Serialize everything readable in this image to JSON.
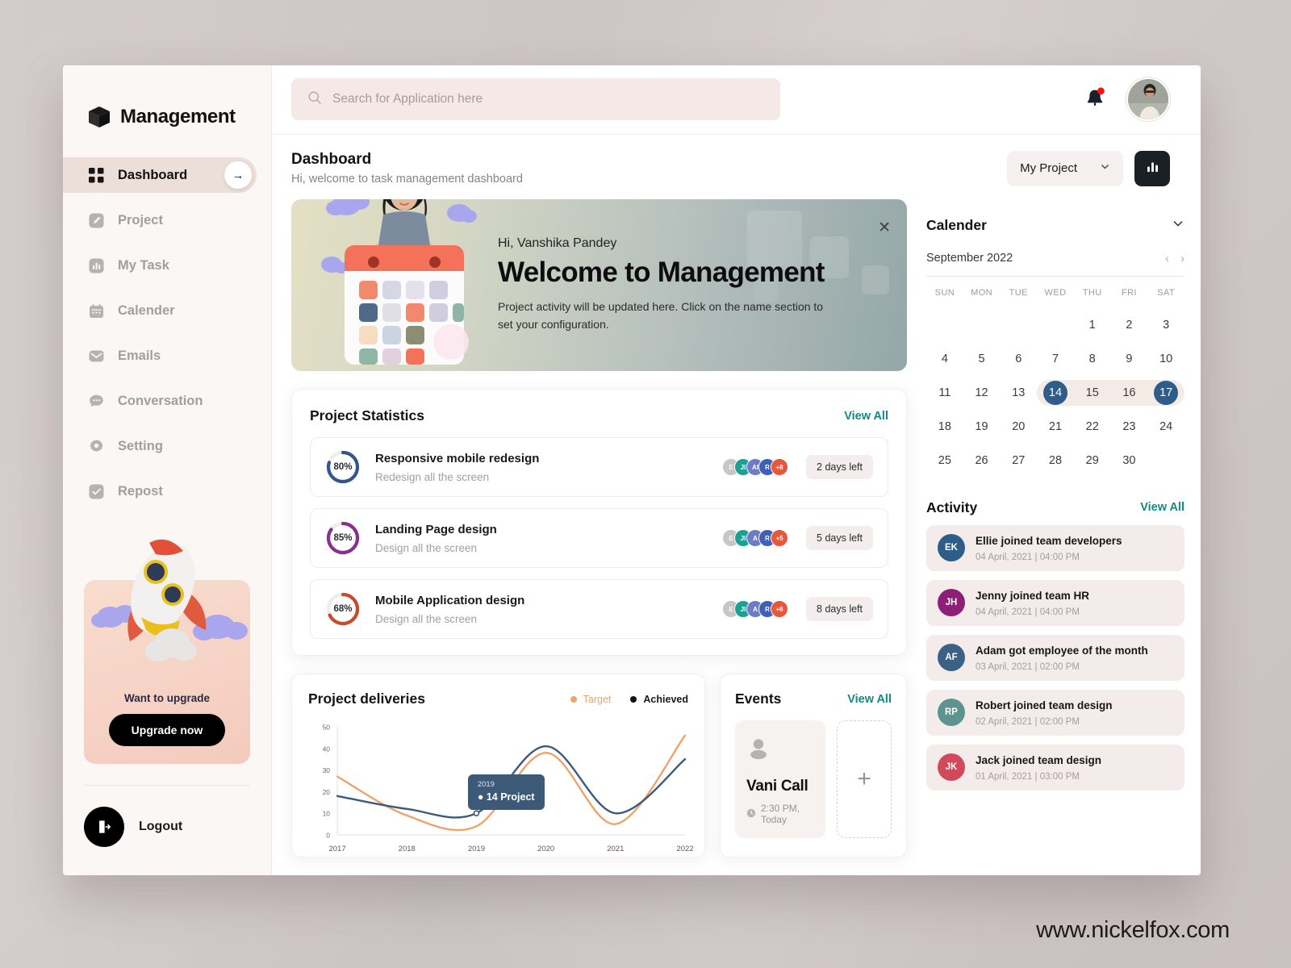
{
  "brand": {
    "name": "Management",
    "logo_icon": "cube-icon"
  },
  "sidebar": {
    "items": [
      {
        "label": "Dashboard",
        "icon": "grid-icon",
        "active": true
      },
      {
        "label": "Project",
        "icon": "edit-icon",
        "active": false
      },
      {
        "label": "My Task",
        "icon": "bar-chart-icon",
        "active": false
      },
      {
        "label": "Calender",
        "icon": "calendar-icon",
        "active": false
      },
      {
        "label": "Emails",
        "icon": "mail-icon",
        "active": false
      },
      {
        "label": "Conversation",
        "icon": "chat-icon",
        "active": false
      },
      {
        "label": "Setting",
        "icon": "gear-icon",
        "active": false
      },
      {
        "label": "Repost",
        "icon": "check-square-icon",
        "active": false
      }
    ],
    "upgrade": {
      "title": "Want to upgrade",
      "button": "Upgrade now",
      "illustration": "rocket-illustration"
    },
    "logout": {
      "label": "Logout",
      "icon": "logout-icon"
    }
  },
  "topbar": {
    "search": {
      "placeholder": "Search for Application here",
      "value": "",
      "icon": "search-icon"
    },
    "notification": {
      "icon": "bell-icon",
      "has_unread": true,
      "badge_color": "#ff0f0f"
    },
    "avatar": {
      "name": "avatar"
    }
  },
  "pagehead": {
    "title": "Dashboard",
    "subtitle": "Hi, welcome to task management dashboard",
    "project_select": {
      "value": "My Project",
      "icon": "chevron-down-icon"
    },
    "chart_button": {
      "icon": "bar-chart-icon"
    }
  },
  "banner": {
    "greeting": "Hi, Vanshika Pandey",
    "heading": "Welcome to Management",
    "body": "Project activity will be updated here. Click on the name section to set your configuration.",
    "close_icon": "close-icon",
    "illustration": "woman-calendar-illustration"
  },
  "project_statistics": {
    "title": "Project Statistics",
    "view_all": "View All",
    "rows": [
      {
        "percent": "80%",
        "percent_value": 80,
        "ring_color": "#35568a",
        "name": "Responsive mobile redesign",
        "desc": "Redesign all the screen",
        "days": "2 days left",
        "avatars": [
          {
            "initials": "E",
            "color": "#c7c5c5"
          },
          {
            "initials": "JI",
            "color": "#1aa196"
          },
          {
            "initials": "AI",
            "color": "#6e7cc4"
          },
          {
            "initials": "R",
            "color": "#4060b8"
          },
          {
            "initials": "+8",
            "color": "#e4593c"
          }
        ]
      },
      {
        "percent": "85%",
        "percent_value": 85,
        "ring_color": "#8a2f8b",
        "name": "Landing Page design",
        "desc": "Design all the screen",
        "days": "5 days left",
        "avatars": [
          {
            "initials": "E",
            "color": "#c7c5c5"
          },
          {
            "initials": "JI",
            "color": "#1aa196"
          },
          {
            "initials": "A",
            "color": "#6e7cc4"
          },
          {
            "initials": "R",
            "color": "#4060b8"
          },
          {
            "initials": "+5",
            "color": "#e4593c"
          }
        ]
      },
      {
        "percent": "68%",
        "percent_value": 68,
        "ring_color": "#c74a2a",
        "name": "Mobile Application design",
        "desc": "Design all the screen",
        "days": "8 days left",
        "avatars": [
          {
            "initials": "E",
            "color": "#c7c5c5"
          },
          {
            "initials": "JI",
            "color": "#1aa196"
          },
          {
            "initials": "A",
            "color": "#6e7cc4"
          },
          {
            "initials": "R",
            "color": "#4060b8"
          },
          {
            "initials": "+6",
            "color": "#e4593c"
          }
        ]
      }
    ]
  },
  "chart_data": {
    "type": "line",
    "title": "Project deliveries",
    "xlabel": "",
    "ylabel": "",
    "x": [
      "2017",
      "2018",
      "2019",
      "2020",
      "2021",
      "2022"
    ],
    "categories": [
      "2017",
      "2018",
      "2019",
      "2020",
      "2021",
      "2022"
    ],
    "ylim": [
      0,
      50
    ],
    "yticks": [
      0,
      10,
      20,
      30,
      40,
      50
    ],
    "grid": false,
    "legend_position": "top-right",
    "series": [
      {
        "name": "Target",
        "color": "#f0a268",
        "values": [
          27,
          9,
          4,
          38,
          5,
          46
        ]
      },
      {
        "name": "Achieved",
        "color": "#3c5a7d",
        "values": [
          18,
          12,
          10,
          41,
          10,
          35
        ]
      }
    ],
    "tooltip": {
      "label": "2019",
      "value": "14 Project",
      "x_index": 2
    },
    "legend": [
      {
        "label": "Target",
        "color": "#f0a268"
      },
      {
        "label": "Achieved",
        "color": "#1a1a1a"
      }
    ]
  },
  "events": {
    "title": "Events",
    "view_all": "View All",
    "items": [
      {
        "name": "Vani Call",
        "time": "2:30 PM, Today",
        "icon": "person-icon",
        "clock_icon": "clock-icon"
      }
    ],
    "add_label": "+"
  },
  "calendar": {
    "title": "Calender",
    "chevron_icon": "chevron-down-icon",
    "month": "September 2022",
    "prev_icon": "chevron-left-icon",
    "next_icon": "chevron-right-icon",
    "dow": [
      "SUN",
      "MON",
      "TUE",
      "WED",
      "THU",
      "FRI",
      "SAT"
    ],
    "weeks": [
      [
        "",
        "",
        "",
        "",
        "1",
        "2",
        "3"
      ],
      [
        "4",
        "5",
        "6",
        "7",
        "8",
        "9",
        "10"
      ],
      [
        "11",
        "12",
        "13",
        "14",
        "15",
        "16",
        "17"
      ],
      [
        "18",
        "19",
        "20",
        "21",
        "22",
        "23",
        "24"
      ],
      [
        "25",
        "26",
        "27",
        "28",
        "29",
        "30",
        ""
      ]
    ],
    "selected_start": "14",
    "selected_end": "17",
    "range_days": [
      "15",
      "16"
    ],
    "accent": "#2f5d8a"
  },
  "activity": {
    "title": "Activity",
    "view_all": "View All",
    "items": [
      {
        "initials": "EK",
        "color": "#2f5d8a",
        "text": "Ellie joined team developers",
        "date": "04 April, 2021 | 04:00 PM"
      },
      {
        "initials": "JH",
        "color": "#8c2076",
        "text": "Jenny joined team HR",
        "date": "04 April, 2021 | 04:00 PM"
      },
      {
        "initials": "AF",
        "color": "#3c6186",
        "text": "Adam got employee of the month",
        "date": "03 April, 2021 | 02:00 PM"
      },
      {
        "initials": "RP",
        "color": "#5d9490",
        "text": "Robert joined team design",
        "date": "02 April, 2021 | 02:00 PM"
      },
      {
        "initials": "JK",
        "color": "#d14a5c",
        "text": "Jack joined team design",
        "date": "01 April, 2021 | 03:00 PM"
      }
    ]
  },
  "watermark": "www.nickelfox.com"
}
